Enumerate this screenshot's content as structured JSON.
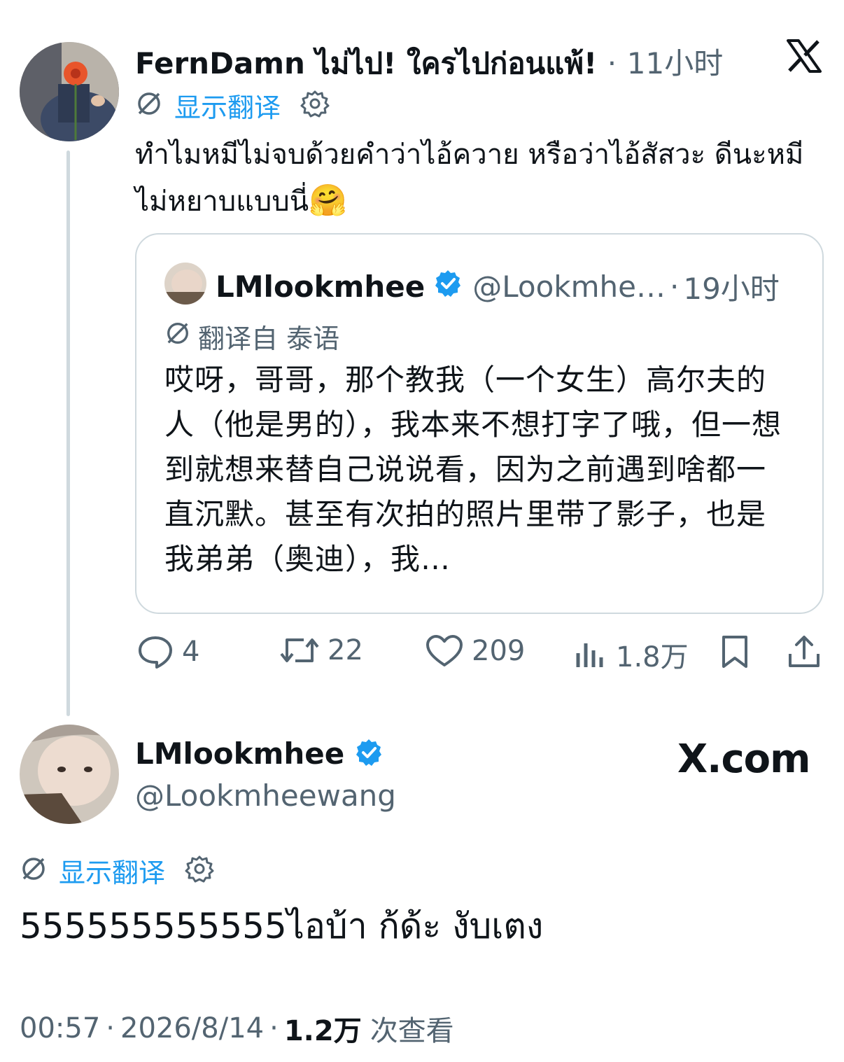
{
  "parent_tweet": {
    "display_name": "FernDamn ไม่ไป! ใครไปก่อนแพ้!",
    "separator": "·",
    "time_ago": "11小时",
    "translate_label": "显示翻译",
    "body": "ทำไมหมีไม่จบด้วยคำว่าไอ้ควาย หรือว่าไอ้สัสวะ ดีนะหมีไม่หยาบแบบนี่",
    "body_emoji": "🤗",
    "quote": {
      "display_name": "LMlookmhee",
      "handle": "@Lookmhe…",
      "separator": "·",
      "time_ago": "19小时",
      "translated_from": "翻译自 泰语",
      "text": "哎呀，哥哥，那个教我（一个女生）高尔夫的人（他是男的），我本来不想打字了哦，但一想到就想来替自己说说看，因为之前遇到啥都一直沉默。甚至有次拍的照片里带了影子，也是我弟弟（奥迪），我…"
    },
    "actions": {
      "replies": "4",
      "retweets": "22",
      "likes": "209",
      "views": "1.8万"
    }
  },
  "main_tweet": {
    "display_name": "LMlookmhee",
    "handle": "@Lookmheewang",
    "translate_label": "显示翻译",
    "body": "555555555555ไอบ้า ก้ด้ะ งับเตง",
    "meta_time": "00:57",
    "meta_date": "2026/8/14",
    "meta_sep": "·",
    "views_count": "1.2万",
    "views_label": "次查看"
  },
  "branding": {
    "x_logo": "x-logo",
    "watermark": "X.com"
  },
  "colors": {
    "accent": "#1d9bf0",
    "text": "#0f1419",
    "secondary": "#536471",
    "border": "#cfd9de"
  }
}
